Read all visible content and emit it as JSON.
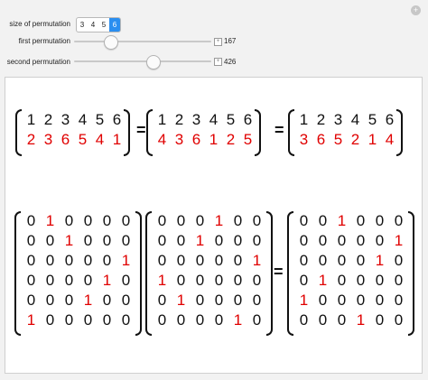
{
  "controls": {
    "size_label": "size of permutation",
    "size_options": [
      "3",
      "4",
      "5",
      "6"
    ],
    "size_selected": "6",
    "first_label": "first permutation",
    "first_value": "167",
    "first_level": 0.24,
    "second_label": "second permutation",
    "second_value": "426",
    "second_level": 0.59
  },
  "colors": {
    "accent": "#2a8ef0",
    "highlight": "#e00000",
    "text": "#111111"
  },
  "permutations": {
    "top": [
      "1",
      "2",
      "3",
      "4",
      "5",
      "6"
    ],
    "first": [
      "2",
      "3",
      "6",
      "5",
      "4",
      "1"
    ],
    "second": [
      "4",
      "3",
      "6",
      "1",
      "2",
      "5"
    ],
    "product": [
      "3",
      "6",
      "5",
      "2",
      "1",
      "4"
    ],
    "equals": "="
  },
  "matrices": {
    "first": [
      [
        "0",
        "1",
        "0",
        "0",
        "0",
        "0"
      ],
      [
        "0",
        "0",
        "1",
        "0",
        "0",
        "0"
      ],
      [
        "0",
        "0",
        "0",
        "0",
        "0",
        "1"
      ],
      [
        "0",
        "0",
        "0",
        "0",
        "1",
        "0"
      ],
      [
        "0",
        "0",
        "0",
        "1",
        "0",
        "0"
      ],
      [
        "1",
        "0",
        "0",
        "0",
        "0",
        "0"
      ]
    ],
    "second": [
      [
        "0",
        "0",
        "0",
        "1",
        "0",
        "0"
      ],
      [
        "0",
        "0",
        "1",
        "0",
        "0",
        "0"
      ],
      [
        "0",
        "0",
        "0",
        "0",
        "0",
        "1"
      ],
      [
        "1",
        "0",
        "0",
        "0",
        "0",
        "0"
      ],
      [
        "0",
        "1",
        "0",
        "0",
        "0",
        "0"
      ],
      [
        "0",
        "0",
        "0",
        "0",
        "1",
        "0"
      ]
    ],
    "product": [
      [
        "0",
        "0",
        "1",
        "0",
        "0",
        "0"
      ],
      [
        "0",
        "0",
        "0",
        "0",
        "0",
        "1"
      ],
      [
        "0",
        "0",
        "0",
        "0",
        "1",
        "0"
      ],
      [
        "0",
        "1",
        "0",
        "0",
        "0",
        "0"
      ],
      [
        "1",
        "0",
        "0",
        "0",
        "0",
        "0"
      ],
      [
        "0",
        "0",
        "0",
        "1",
        "0",
        "0"
      ]
    ],
    "equals": "="
  }
}
